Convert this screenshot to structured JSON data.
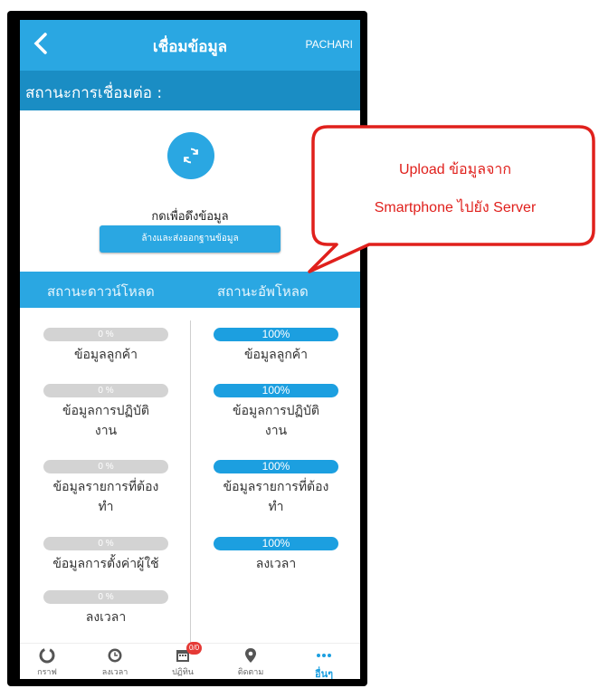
{
  "appbar": {
    "back_icon": "chevron-left-icon",
    "title": "เชื่อมข้อมูล",
    "user": "PACHARI"
  },
  "status": {
    "label": "สถานะการเชื่อมต่อ :"
  },
  "sync": {
    "icon": "sync-icon",
    "pull_text": "กดเพื่อดึงข้อมูล",
    "reset_button": "ล้างและส่งออกฐานข้อมูล"
  },
  "columns": {
    "download_header": "สถานะดาวน์โหลด",
    "upload_header": "สถานะอัพโหลด"
  },
  "download": [
    {
      "percent": "0 %",
      "label": "ข้อมูลลูกค้า"
    },
    {
      "percent": "0 %",
      "label": "ข้อมูลการปฏิบัติ\nงาน"
    },
    {
      "percent": "0 %",
      "label": "ข้อมูลรายการที่ต้อง\nทำ"
    },
    {
      "percent": "0 %",
      "label": "ข้อมูลการตั้งค่าผู้ใช้"
    },
    {
      "percent": "0 %",
      "label": "ลงเวลา"
    }
  ],
  "upload": [
    {
      "percent": "100%",
      "label": "ข้อมูลลูกค้า"
    },
    {
      "percent": "100%",
      "label": "ข้อมูลการปฏิบัติ\nงาน"
    },
    {
      "percent": "100%",
      "label": "ข้อมูลรายการที่ต้อง\nทำ"
    },
    {
      "percent": "100%",
      "label": "ลงเวลา"
    }
  ],
  "nav": [
    {
      "icon": "chart-icon",
      "label": "กราฟ"
    },
    {
      "icon": "clock-icon",
      "label": "ลงเวลา"
    },
    {
      "icon": "calendar-icon",
      "label": "ปฏิทิน",
      "badge": "0/0"
    },
    {
      "icon": "location-pin-icon",
      "label": "ติดตาม"
    },
    {
      "icon": "more-icon",
      "label": "อื่นๆ"
    }
  ],
  "callout": {
    "line1": "Upload ข้อมูลจาก",
    "line2": "Smartphone ไปยัง Server"
  },
  "colors": {
    "primary": "#2aa7e2",
    "dark": "#1a8dc4",
    "callout": "#e0201c"
  }
}
